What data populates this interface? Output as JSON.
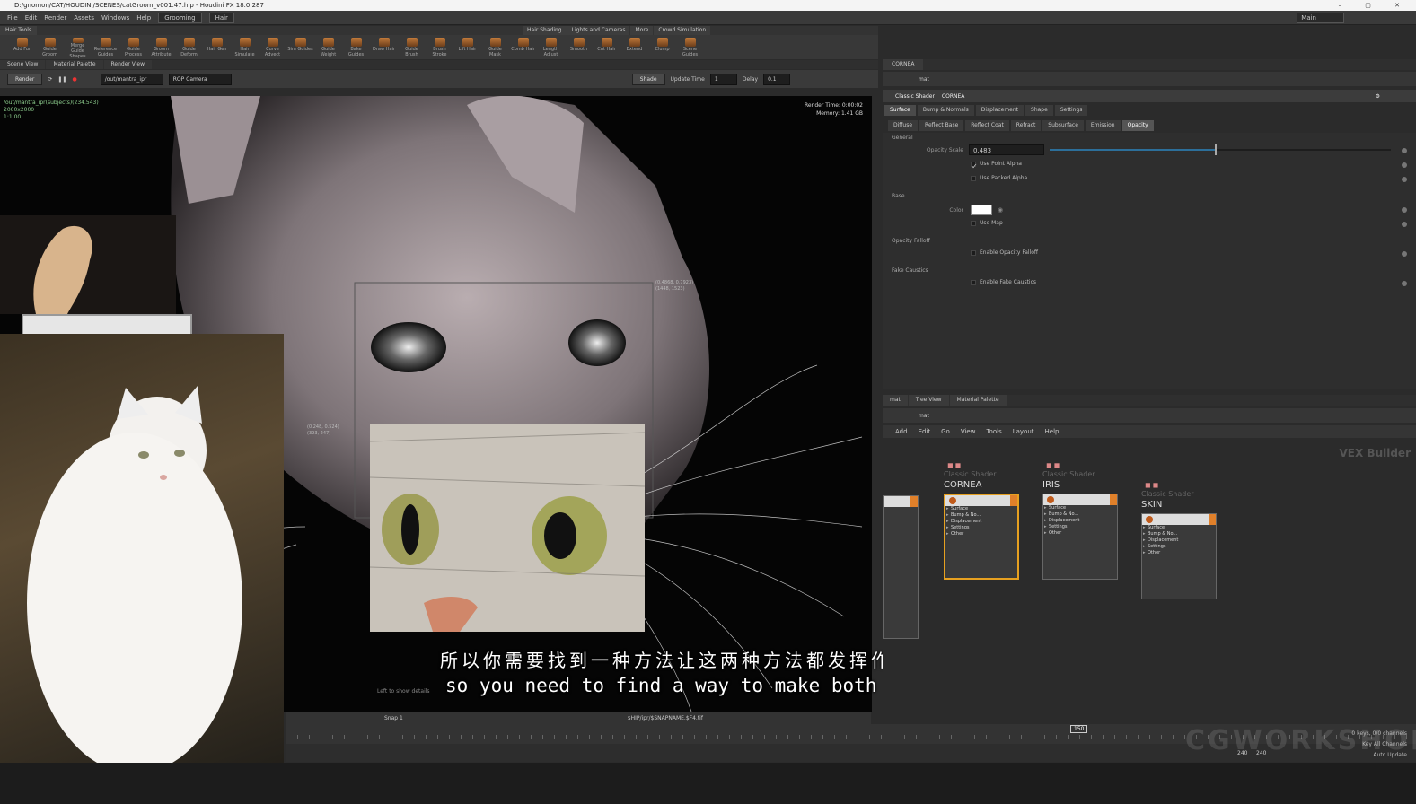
{
  "window": {
    "title": "D:/gnomon/CAT/HOUDINI/SCENES/catGroom_v001.47.hip - Houdini FX 18.0.287",
    "controls": "–  ▢  ✕"
  },
  "menu": {
    "items": [
      "File",
      "Edit",
      "Render",
      "Assets",
      "Windows",
      "Help"
    ],
    "desktop": "Grooming",
    "context": "Hair",
    "right_field": "Main"
  },
  "shelf": {
    "left_tabs": [
      "Hair Tools"
    ],
    "right_tabs": [
      "Hair Shading",
      "Lights and Cameras",
      "More",
      "Crowd Simulation"
    ],
    "tools": [
      "Add Fur",
      "Guide Groom",
      "Merge Guide Shapes",
      "Reference Guides",
      "Guide Process",
      "Groom Attribute",
      "Guide Deform",
      "Hair Gen",
      "Hair Simulate",
      "Curve Advect",
      "Sim Guides",
      "Guide Weight",
      "Bake Guides",
      "Draw Hair",
      "Guide Brush",
      "Brush Stroke",
      "Lift Hair",
      "Guide Mask",
      "Comb Hair",
      "Length Adjust",
      "Smooth",
      "Cut Hair",
      "Extend",
      "Clump",
      "Scene Guides"
    ]
  },
  "viewer": {
    "tabs": [
      "Scene View",
      "Material Palette",
      "Render View"
    ],
    "render_btn": "Render",
    "rop_field": "/out/mantra_ipr",
    "camera_field": "ROP Camera",
    "shade_label": "Shade",
    "update_label": "Update Time",
    "update_value": "1",
    "delay_label": "Delay",
    "delay_value": "0.1",
    "info_line1": "/out/mantra_ipr(subjects)(234.543)",
    "info_line2": "2000x2000",
    "info_line3": "1:1.00",
    "render_time": "Render Time: 0:00:02",
    "memory": "Memory: 1.41 GB",
    "coord1_a": "(0.4868, 0.7923)",
    "coord1_b": "(1448, 1523)",
    "coord2_a": "(0.248, 0.524)",
    "coord2_b": "(393, 247)",
    "hint": "Left to show details",
    "snap": "Snap 1",
    "path": "$HIP/ipr/$SNAPNAME.$F4.tif"
  },
  "subtitles": {
    "cn": "所以你需要找到一种方法让这两种方法都发挥作用",
    "en": "so you need to find a way to make both work"
  },
  "params": {
    "tabs": [
      "CORNEA"
    ],
    "path": "mat",
    "shader_type": "Classic Shader",
    "shader_name": "CORNEA",
    "main_tabs": [
      "Surface",
      "Bump & Normals",
      "Displacement",
      "Shape",
      "Settings"
    ],
    "sub_tabs": [
      "Diffuse",
      "Reflect Base",
      "Reflect Coat",
      "Refract",
      "Subsurface",
      "Emission",
      "Opacity"
    ],
    "general": "General",
    "opacity_scale_label": "Opacity Scale",
    "opacity_scale_value": "0.483",
    "opacity_scale_fraction": 0.483,
    "use_point_alpha": "Use Point Alpha",
    "use_packed_alpha": "Use Packed Alpha",
    "base_section": "Base",
    "color_label": "Color",
    "use_map": "Use Map",
    "opacity_falloff_section": "Opacity Falloff",
    "enable_opacity_falloff": "Enable Opacity Falloff",
    "fake_caustics_section": "Fake Caustics",
    "enable_fake_caustics": "Enable Fake Caustics"
  },
  "network": {
    "tabs": [
      "mat",
      "Tree View",
      "Material Palette"
    ],
    "path": "mat",
    "menu": [
      "Add",
      "Edit",
      "Go",
      "View",
      "Tools",
      "Layout",
      "Help"
    ],
    "context_label": "VEX Builder",
    "nodes": [
      {
        "type": "Classic Shader",
        "name": "CORNEA",
        "rows": [
          "Surface",
          "Bump & No...",
          "Displacement",
          "Settings",
          "Other"
        ]
      },
      {
        "type": "Classic Shader",
        "name": "IRIS",
        "rows": [
          "Surface",
          "Bump & No...",
          "Displacement",
          "Settings",
          "Other"
        ]
      },
      {
        "type": "Classic Shader",
        "name": "SKIN",
        "rows": [
          "Surface",
          "Bump & No...",
          "Displacement",
          "Settings",
          "Other"
        ]
      }
    ]
  },
  "timeline": {
    "frame": "150",
    "start": "240",
    "end": "240",
    "keys_label": "0 keys, 0/0 channels",
    "key_all": "Key All Channels",
    "auto_update": "Auto Update"
  },
  "watermark": "CGWORKSHOPS"
}
